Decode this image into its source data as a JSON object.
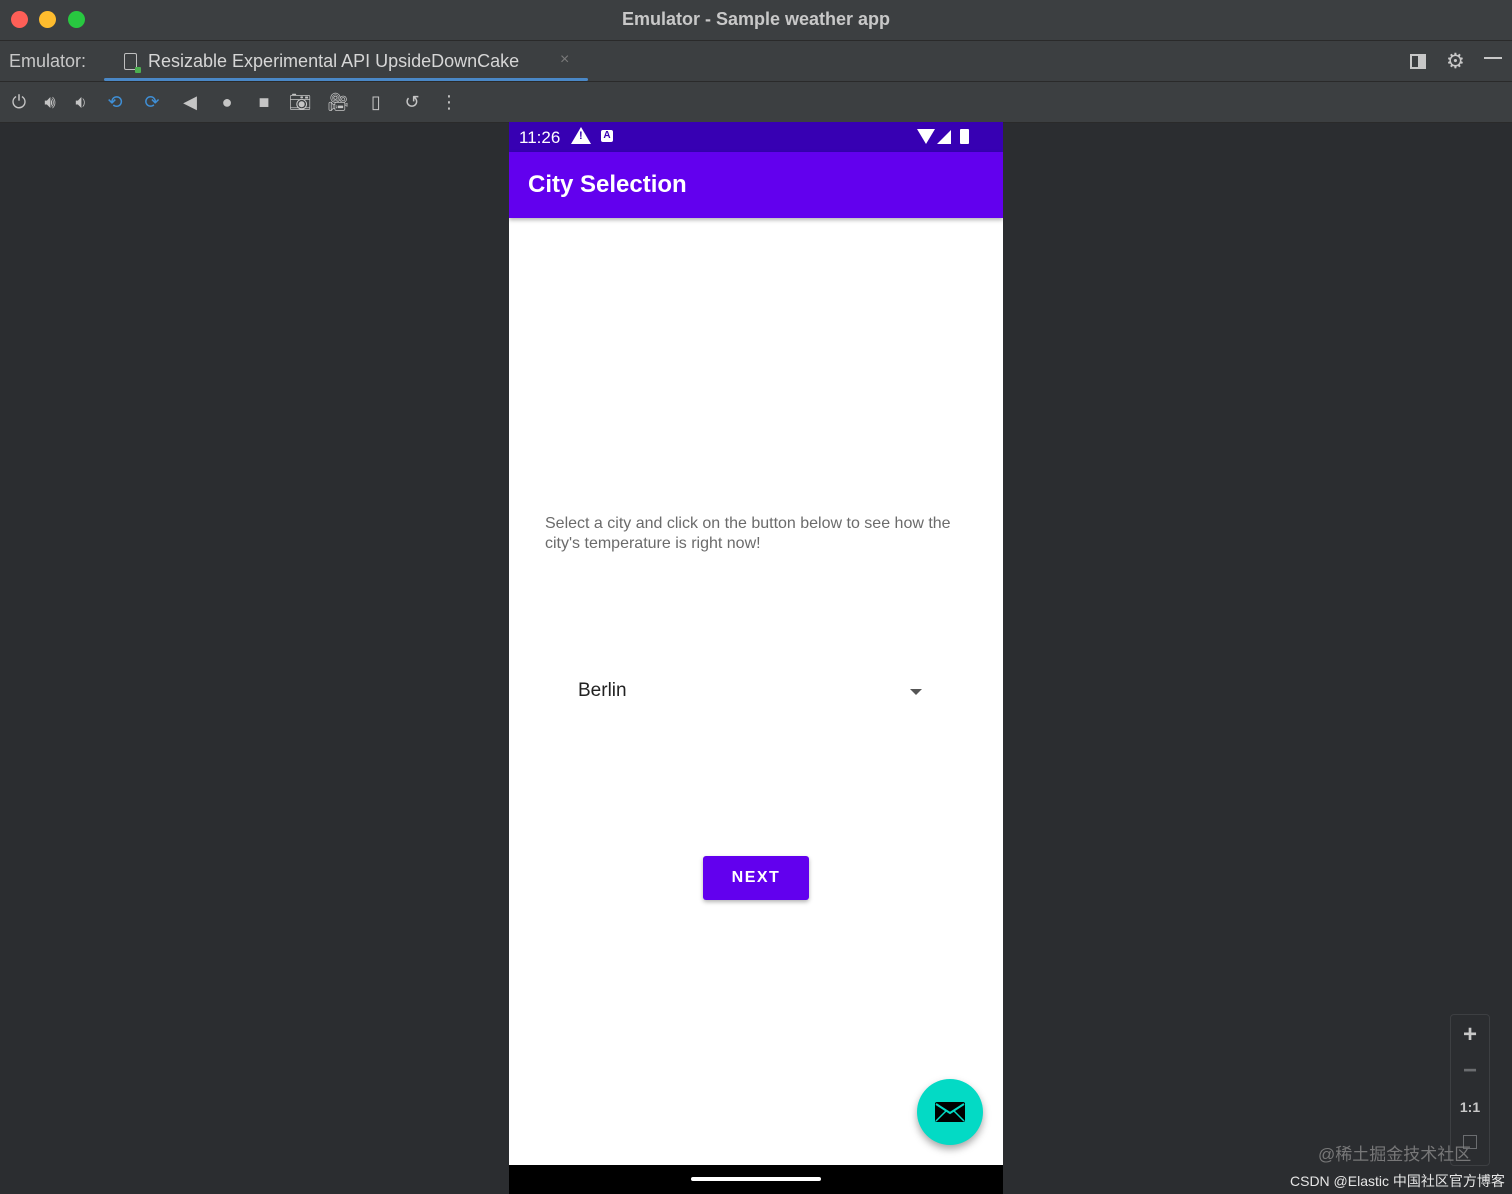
{
  "window": {
    "title": "Emulator - Sample weather app"
  },
  "tabbar": {
    "prefix": "Emulator:",
    "tab_label": "Resizable Experimental API UpsideDownCake",
    "tab_close": "×"
  },
  "toolbar": {
    "icons": [
      "power-icon",
      "volume-up-icon",
      "volume-down-icon",
      "rotate-left-icon",
      "rotate-right-icon",
      "back-icon",
      "home-icon",
      "overview-icon",
      "camera-icon",
      "record-icon",
      "fold-icon",
      "snapshot-icon",
      "more-icon"
    ]
  },
  "phone": {
    "status_time": "11:26",
    "app_title": "City Selection",
    "description": "Select a city and click on the button below to see how the city's temperature is right now!",
    "spinner_value": "Berlin",
    "next_label": "NEXT",
    "colors": {
      "status_bar": "#3700b3",
      "app_bar": "#6200ee",
      "fab": "#03dac5"
    }
  },
  "zoom": {
    "in": "+",
    "out": "−",
    "one_to_one": "1:1"
  },
  "watermark": {
    "line1": "@稀土掘金技术社区",
    "line2": "CSDN @Elastic 中国社区官方博客"
  }
}
